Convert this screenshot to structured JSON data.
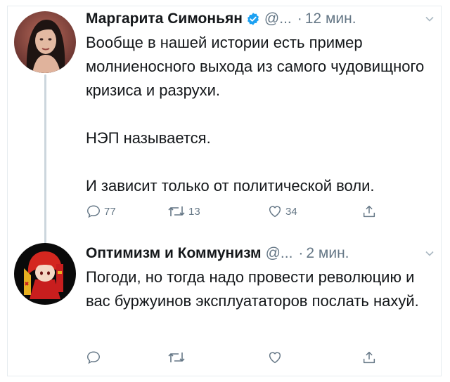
{
  "tweets": [
    {
      "name": "Маргарита Симоньян",
      "verified": true,
      "handle": "@...",
      "dot": "·",
      "time": "12 мин.",
      "paragraphs": [
        "Вообще в нашей истории есть пример молниеносного выхода из самого чудовищного кризиса и разрухи.",
        "НЭП называется.",
        "И зависит только от политической воли."
      ],
      "reply_count": "77",
      "retweet_count": "13",
      "like_count": "34",
      "avatar_icon": "woman-portrait-avatar"
    },
    {
      "name": "Оптимизм и Коммунизм",
      "verified": false,
      "handle": "@...",
      "dot": "·",
      "time": "2 мин.",
      "paragraphs": [
        "Погоди, но тогда надо провести революцию и вас буржуинов эксплуататоров послать нахуй."
      ],
      "reply_count": "",
      "retweet_count": "",
      "like_count": "",
      "avatar_icon": "anime-girl-hammer-sickle-avatar"
    }
  ],
  "colors": {
    "text": "#14171a",
    "secondary": "#657786",
    "verified": "#1da1f2",
    "thread_line": "#ccd6dd"
  }
}
